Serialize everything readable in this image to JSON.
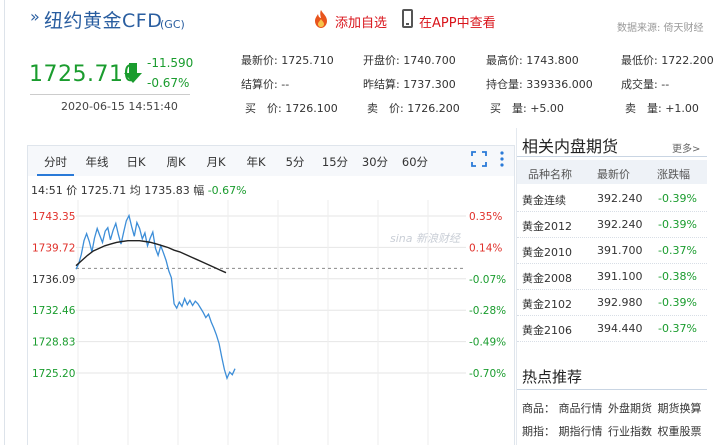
{
  "header": {
    "arrows": "»",
    "title": "纽约黄金CFD",
    "code": "(GC)",
    "fav_label": "添加自选",
    "app_label": "在APP中查看",
    "source": "数据来源: 倚天财经"
  },
  "price": {
    "current": "1725.710",
    "change_abs": "-11.590",
    "change_pct": "-0.67%",
    "timestamp": "2020-06-15 14:51:40",
    "direction": "down",
    "color": "#1a9c2e"
  },
  "stats": {
    "latest": {
      "label": "最新价:",
      "value": "1725.710"
    },
    "open": {
      "label": "开盘价:",
      "value": "1740.700"
    },
    "high": {
      "label": "最高价:",
      "value": "1743.800"
    },
    "low": {
      "label": "最低价:",
      "value": "1722.200"
    },
    "settle": {
      "label": "结算价:",
      "value": "--"
    },
    "prev_settle": {
      "label": "昨结算:",
      "value": "1737.300"
    },
    "open_interest": {
      "label": "持仓量:",
      "value": "339336.000"
    },
    "volume": {
      "label": "成交量:",
      "value": "--"
    },
    "bid": {
      "label": "买　价:",
      "value": "1726.100"
    },
    "ask": {
      "label": "卖　价:",
      "value": "1726.200"
    },
    "bid_vol": {
      "label": "买　量:",
      "value": "+5.00"
    },
    "ask_vol": {
      "label": "卖　量:",
      "value": "+1.00"
    }
  },
  "tabs": [
    "分时",
    "年线",
    "日K",
    "周K",
    "月K",
    "年K",
    "5分",
    "15分",
    "30分",
    "60分"
  ],
  "active_tab": "分时",
  "info_line": {
    "time": "14:51",
    "price_label": "价",
    "price": "1725.71",
    "avg_label": "均",
    "avg": "1735.83",
    "amp_label": "幅",
    "amp": "-0.67%"
  },
  "watermark": "sina 新浪财经",
  "chart_data": {
    "type": "line",
    "y_ticks_left": [
      "1743.35",
      "1739.72",
      "1736.09",
      "1732.46",
      "1728.83",
      "1725.20"
    ],
    "y_ticks_right": [
      "0.35%",
      "0.14%",
      "-0.07%",
      "-0.28%",
      "-0.49%",
      "-0.70%"
    ],
    "ylim": [
      1725.2,
      1743.35
    ],
    "reference": 1737.3,
    "colors": {
      "price": "#3d8ed8",
      "avg": "#222222",
      "up": "#e0302a",
      "down": "#1a9c2e",
      "grid": "#e6e6e6"
    },
    "series": [
      {
        "name": "价",
        "values": [
          1737.2,
          1737.8,
          1738.9,
          1740.5,
          1741.3,
          1740.4,
          1739.2,
          1740.8,
          1741.9,
          1741.1,
          1740.3,
          1741.6,
          1742.0,
          1740.6,
          1741.7,
          1742.5,
          1741.2,
          1740.1,
          1741.5,
          1742.8,
          1743.4,
          1742.1,
          1741.0,
          1742.6,
          1741.9,
          1740.7,
          1741.4,
          1739.9,
          1740.8,
          1741.5,
          1739.6,
          1738.8,
          1739.9,
          1739.1,
          1738.2,
          1737.0,
          1736.2,
          1733.2,
          1732.7,
          1733.4,
          1732.9,
          1733.8,
          1733.1,
          1733.6,
          1733.0,
          1733.5,
          1733.2,
          1732.7,
          1732.2,
          1731.6,
          1732.0,
          1731.1,
          1730.4,
          1729.6,
          1728.6,
          1727.0,
          1725.6,
          1724.6,
          1725.3,
          1725.0,
          1725.7
        ]
      },
      {
        "name": "均",
        "values": [
          1737.6,
          1738.2,
          1738.8,
          1739.3,
          1739.6,
          1739.9,
          1740.1,
          1740.3,
          1740.4,
          1740.5,
          1740.5,
          1740.5,
          1740.4,
          1740.3,
          1740.1,
          1739.9,
          1739.7,
          1739.4,
          1739.2,
          1738.9,
          1738.6,
          1738.3,
          1738.0,
          1737.7,
          1737.4,
          1737.1,
          1736.8
        ]
      }
    ]
  }
}
